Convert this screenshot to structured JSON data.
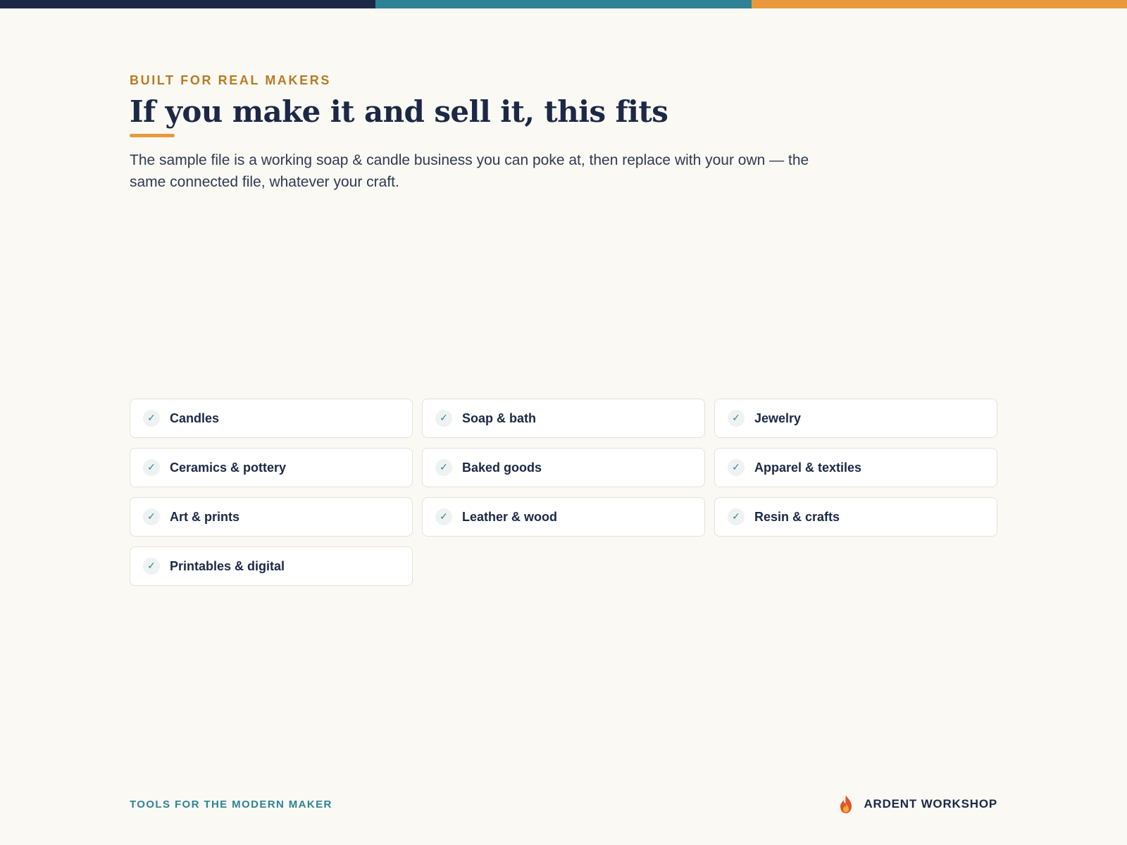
{
  "top_bar": {
    "colors": [
      "#1c2846",
      "#2e8296",
      "#e9993b"
    ]
  },
  "header": {
    "eyebrow": "BUILT FOR REAL MAKERS",
    "title": "If you make it and sell it, this fits",
    "subtitle": "The sample file is a working soap & candle business you can poke at, then replace with your own — the same connected file, whatever your craft."
  },
  "crafts": {
    "check_glyph": "✓",
    "items": [
      {
        "label": "Candles",
        "icon": "check-icon"
      },
      {
        "label": "Soap & bath",
        "icon": "check-icon"
      },
      {
        "label": "Jewelry",
        "icon": "check-icon"
      },
      {
        "label": "Ceramics & pottery",
        "icon": "check-icon"
      },
      {
        "label": "Baked goods",
        "icon": "check-icon"
      },
      {
        "label": "Apparel & textiles",
        "icon": "check-icon"
      },
      {
        "label": "Art & prints",
        "icon": "check-icon"
      },
      {
        "label": "Leather & wood",
        "icon": "check-icon"
      },
      {
        "label": "Resin & crafts",
        "icon": "check-icon"
      },
      {
        "label": "Printables & digital",
        "icon": "check-icon"
      }
    ]
  },
  "footer": {
    "tagline": "TOOLS FOR THE MODERN MAKER",
    "brand": "ARDENT WORKSHOP",
    "logo_icon": "flame-icon"
  },
  "colors": {
    "background": "#faf9f4",
    "navy": "#1c2846",
    "teal": "#2e8296",
    "orange": "#e9993b",
    "eyebrow": "#b97a22"
  }
}
